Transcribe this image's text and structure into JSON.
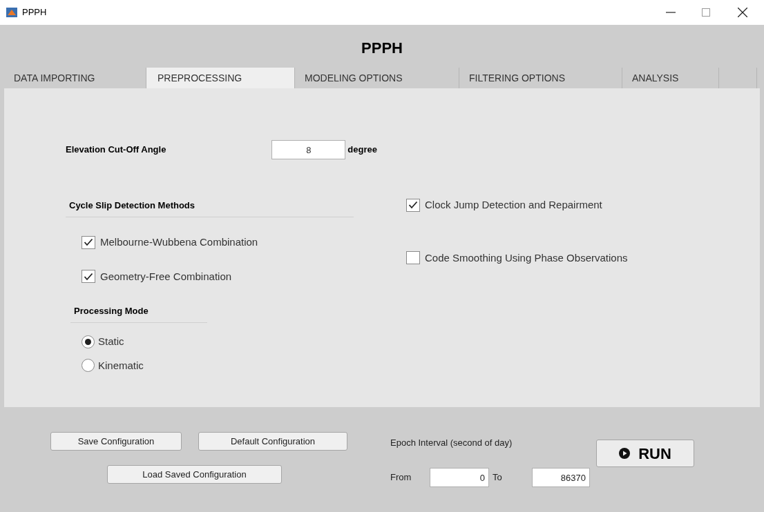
{
  "window": {
    "title": "PPPH"
  },
  "header": "PPPH",
  "tabs": [
    {
      "label": "DATA IMPORTING",
      "selected": false
    },
    {
      "label": "PREPROCESSING",
      "selected": true
    },
    {
      "label": "MODELING OPTIONS",
      "selected": false
    },
    {
      "label": "FILTERING OPTIONS",
      "selected": false
    },
    {
      "label": "ANALYSIS",
      "selected": false
    }
  ],
  "elevation": {
    "label": "Elevation Cut-Off Angle",
    "value": "8",
    "unit": "degree"
  },
  "cycle_slip": {
    "title": "Cycle Slip Detection Methods",
    "options": [
      {
        "label": "Melbourne-Wubbena Combination",
        "checked": true
      },
      {
        "label": "Geometry-Free Combination",
        "checked": true
      }
    ]
  },
  "processing_mode": {
    "title": "Processing Mode",
    "options": [
      {
        "label": "Static",
        "selected": true
      },
      {
        "label": "Kinematic",
        "selected": false
      }
    ]
  },
  "right_options": [
    {
      "label": "Clock Jump Detection and Repairment",
      "checked": true
    },
    {
      "label": "Code Smoothing Using Phase Observations",
      "checked": false
    }
  ],
  "buttons": {
    "save": "Save Configuration",
    "default": "Default Configuration",
    "load": "Load Saved Configuration"
  },
  "epoch": {
    "label": "Epoch Interval (second of day)",
    "from_label": "From",
    "from": "0",
    "to_label": "To",
    "to": "86370"
  },
  "run": "RUN"
}
